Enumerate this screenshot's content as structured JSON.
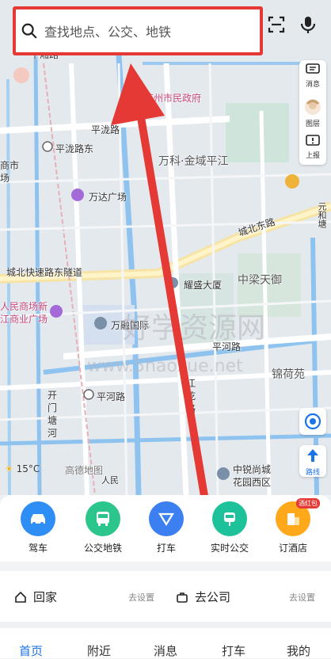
{
  "search": {
    "placeholder": "查找地点、公交、地铁"
  },
  "map_labels": {
    "top_road": "平湘路",
    "gov": "苏州市民政府",
    "pinglong_road": "平泷路",
    "pinglong_station": "平泷路东",
    "market_left": "商市",
    "market_left2": "场",
    "wanke": "万科·金域平江",
    "wanda": "万达广场",
    "chengbei_east": "城北东路",
    "yuanhe": "元和塘",
    "expressway": "城北快速路东隧道",
    "zhongliang": "中梁天御",
    "yaosheng": "耀盛大厦",
    "renmin1": "人民商场新",
    "renmin2": "江商业广场",
    "wanrong": "万融国际",
    "pinghe_road": "平河路",
    "jinhe": "锦荷苑",
    "kaimen1": "开",
    "kaimen2": "门",
    "kaimen3": "塘",
    "kaimen4": "河",
    "pinghe_station": "平河路",
    "jiangqian1": "江",
    "jiangqian2": "乾",
    "jiangqian3": "路",
    "zhongrui1": "中锐尚城",
    "zhongrui2": "花园西区",
    "renminroad": "人民",
    "amap_logo": "高德地图",
    "watermark1": "好学资源网",
    "watermark2": "www.5haoxue.net"
  },
  "weather": {
    "temp": "15°C"
  },
  "right_panel": {
    "messages": "消息",
    "layers": "图层",
    "report": "上报"
  },
  "route_label": "路线",
  "quick_actions": [
    {
      "label": "驾车",
      "color": "#2f8ef5"
    },
    {
      "label": "公交地铁",
      "color": "#2cc58c"
    },
    {
      "label": "打车",
      "color": "#3b7ff0"
    },
    {
      "label": "实时公交",
      "color": "#1ec29a"
    },
    {
      "label": "订酒店",
      "color": "#ffa81a",
      "badge": "酒红包"
    }
  ],
  "places": {
    "home": "回家",
    "home_set": "去设置",
    "company": "去公司",
    "company_set": "去设置"
  },
  "tabs": [
    "首页",
    "附近",
    "消息",
    "打车",
    "我的"
  ]
}
